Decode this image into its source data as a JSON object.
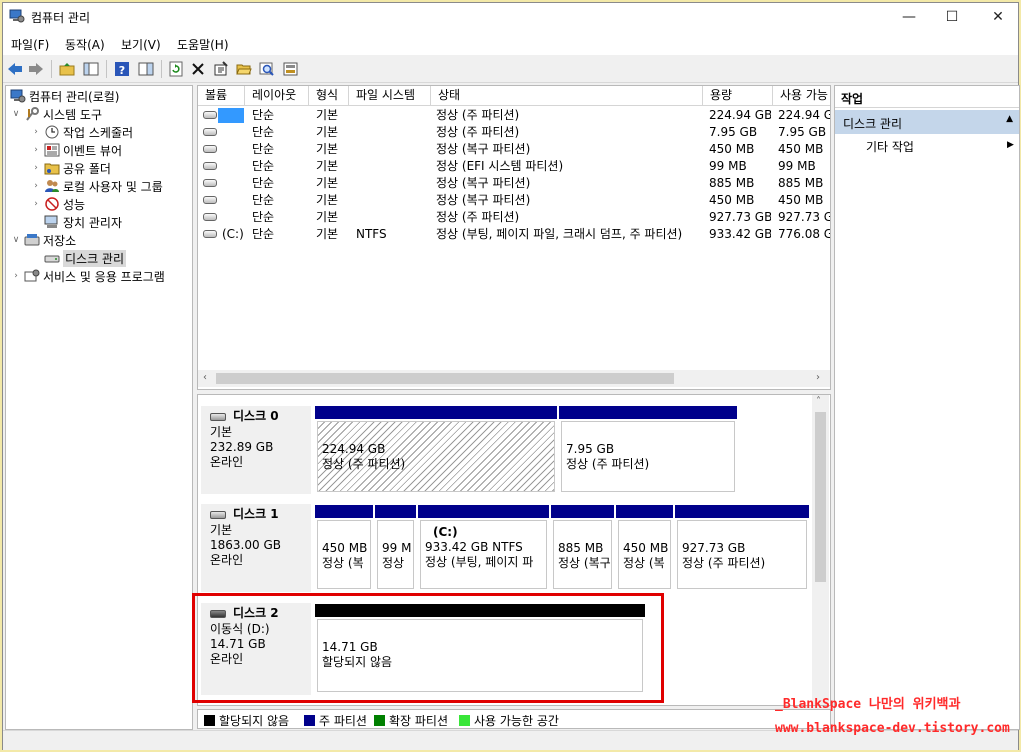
{
  "window": {
    "title": "컴퓨터 관리",
    "minimize": "—",
    "maximize": "☐",
    "close": "✕"
  },
  "menu": [
    "파일(F)",
    "동작(A)",
    "보기(V)",
    "도움말(H)"
  ],
  "toolbar": [
    "back-icon",
    "forward-icon",
    "up-folder-icon",
    "show-tree-icon",
    "help-icon",
    "properties-pane-icon",
    "refresh-icon",
    "delete-icon",
    "properties-icon",
    "open-icon",
    "search-icon",
    "rescan-icon"
  ],
  "tree": {
    "root": "컴퓨터 관리(로컬)",
    "system_tools": "시스템 도구",
    "task_scheduler": "작업 스케줄러",
    "event_viewer": "이벤트 뷰어",
    "shared_folders": "공유 폴더",
    "local_users": "로컬 사용자 및 그룹",
    "performance": "성능",
    "device_manager": "장치 관리자",
    "storage": "저장소",
    "disk_management": "디스크 관리",
    "services": "서비스 및 응용 프로그램"
  },
  "volume_list": {
    "columns": [
      "볼륨",
      "레이아웃",
      "형식",
      "파일 시스템",
      "상태",
      "용량",
      "사용 가능"
    ],
    "rows": [
      {
        "volume": "",
        "layout": "단순",
        "type": "기본",
        "fs": "",
        "status": "정상 (주 파티션)",
        "capacity": "224.94 GB",
        "free": "224.94 G"
      },
      {
        "volume": "",
        "layout": "단순",
        "type": "기본",
        "fs": "",
        "status": "정상 (주 파티션)",
        "capacity": "7.95 GB",
        "free": "7.95 GB"
      },
      {
        "volume": "",
        "layout": "단순",
        "type": "기본",
        "fs": "",
        "status": "정상 (복구 파티션)",
        "capacity": "450 MB",
        "free": "450 MB"
      },
      {
        "volume": "",
        "layout": "단순",
        "type": "기본",
        "fs": "",
        "status": "정상 (EFI 시스템 파티션)",
        "capacity": "99 MB",
        "free": "99 MB"
      },
      {
        "volume": "",
        "layout": "단순",
        "type": "기본",
        "fs": "",
        "status": "정상 (복구 파티션)",
        "capacity": "885 MB",
        "free": "885 MB"
      },
      {
        "volume": "",
        "layout": "단순",
        "type": "기본",
        "fs": "",
        "status": "정상 (복구 파티션)",
        "capacity": "450 MB",
        "free": "450 MB"
      },
      {
        "volume": "",
        "layout": "단순",
        "type": "기본",
        "fs": "",
        "status": "정상 (주 파티션)",
        "capacity": "927.73 GB",
        "free": "927.73 G"
      },
      {
        "volume": "(C:)",
        "layout": "단순",
        "type": "기본",
        "fs": "NTFS",
        "status": "정상 (부팅, 페이지 파일, 크래시 덤프, 주 파티션)",
        "capacity": "933.42 GB",
        "free": "776.08 G"
      }
    ]
  },
  "disks": [
    {
      "name": "디스크 0",
      "kind": "기본",
      "size": "232.89 GB",
      "state": "온라인",
      "partitions": [
        {
          "line1": "224.94 GB",
          "line2": "정상 (주 파티션)",
          "hatched": true
        },
        {
          "line1": "7.95 GB",
          "line2": "정상 (주 파티션)"
        }
      ]
    },
    {
      "name": "디스크 1",
      "kind": "기본",
      "size": "1863.00 GB",
      "state": "온라인",
      "partitions": [
        {
          "line1": "450 MB",
          "line2": "정상 (복"
        },
        {
          "line1": "99 M",
          "line2": "정상"
        },
        {
          "label": "(C:)",
          "line1": "933.42 GB NTFS",
          "line2": "정상 (부팅, 페이지 파"
        },
        {
          "line1": "885 MB",
          "line2": "정상 (복구"
        },
        {
          "line1": "450 MB",
          "line2": "정상 (복"
        },
        {
          "line1": "927.73 GB",
          "line2": "정상 (주 파티션)"
        }
      ]
    },
    {
      "name": "디스크 2",
      "kind": "이동식 (D:)",
      "size": "14.71 GB",
      "state": "온라인",
      "partitions": [
        {
          "line1": "14.71 GB",
          "line2": "할당되지 않음",
          "unallocated": true
        }
      ]
    }
  ],
  "legend": [
    {
      "label": "할당되지 않음",
      "color": "#000000"
    },
    {
      "label": "주 파티션",
      "color": "#00008b"
    },
    {
      "label": "확장 파티션",
      "color": "#008000"
    },
    {
      "label": "사용 가능한 공간",
      "color": "#39e639"
    }
  ],
  "actions": {
    "header": "작업",
    "section": "디스크 관리",
    "item": "기타 작업"
  },
  "watermark": {
    "line1": "_BlankSpace 나만의 위키백과",
    "line2": "www.blankspace-dev.tistory.com"
  }
}
